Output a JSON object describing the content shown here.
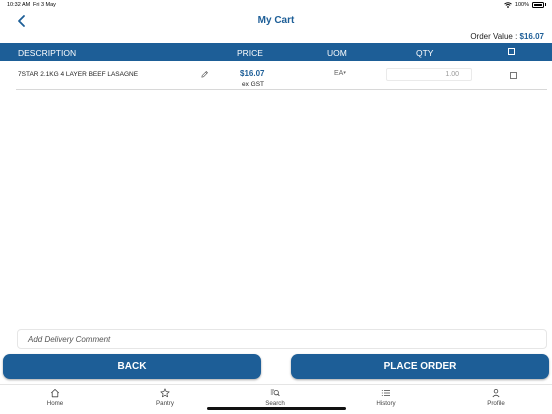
{
  "status_bar": {
    "time": "10:32 AM",
    "date": "Fri 3 May",
    "battery": "100%"
  },
  "header": {
    "title": "My Cart",
    "back_icon": "chevron-left-icon"
  },
  "order": {
    "label": "Order Value :",
    "amount": "$16.07"
  },
  "table": {
    "columns": [
      "DESCRIPTION",
      "PRICE",
      "UOM",
      "QTY"
    ],
    "rows": [
      {
        "description": "7STAR 2.1KG 4 LAYER BEEF LASAGNE",
        "price": "$16.07",
        "price_note": "ex GST",
        "uom": "EA",
        "qty": "1.00",
        "checked": false
      }
    ]
  },
  "comment": {
    "placeholder": "Add Delivery Comment"
  },
  "buttons": {
    "back": "BACK",
    "place_order": "PLACE ORDER"
  },
  "tabs": [
    {
      "label": "Home",
      "icon": "home-icon"
    },
    {
      "label": "Pantry",
      "icon": "star-icon"
    },
    {
      "label": "Search",
      "icon": "search-icon"
    },
    {
      "label": "History",
      "icon": "list-icon"
    },
    {
      "label": "Profile",
      "icon": "person-icon"
    }
  ],
  "colors": {
    "primary": "#1d5e97",
    "background": "#ffffff"
  }
}
